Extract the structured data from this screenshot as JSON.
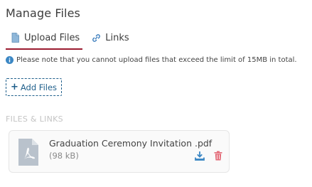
{
  "page": {
    "title": "Manage Files"
  },
  "tabs": [
    {
      "label": "Upload Files",
      "icon": "file-icon",
      "active": true
    },
    {
      "label": "Links",
      "icon": "link-icon",
      "active": false
    }
  ],
  "notice": {
    "icon": "info-icon",
    "text": "Please note that you cannot upload files that exceed the limit of 15MB in total."
  },
  "add_files": {
    "icon": "plus-icon",
    "label": "Add Files"
  },
  "section": {
    "label": "FILES & LINKS"
  },
  "files": [
    {
      "icon": "pdf-file-icon",
      "name": "Graduation Ceremony Invitation .pdf",
      "size": "(98 kB)"
    }
  ],
  "colors": {
    "accent": "#9b1b30",
    "link": "#1f5f8b",
    "download": "#3b87c4",
    "delete": "#e36b78"
  }
}
